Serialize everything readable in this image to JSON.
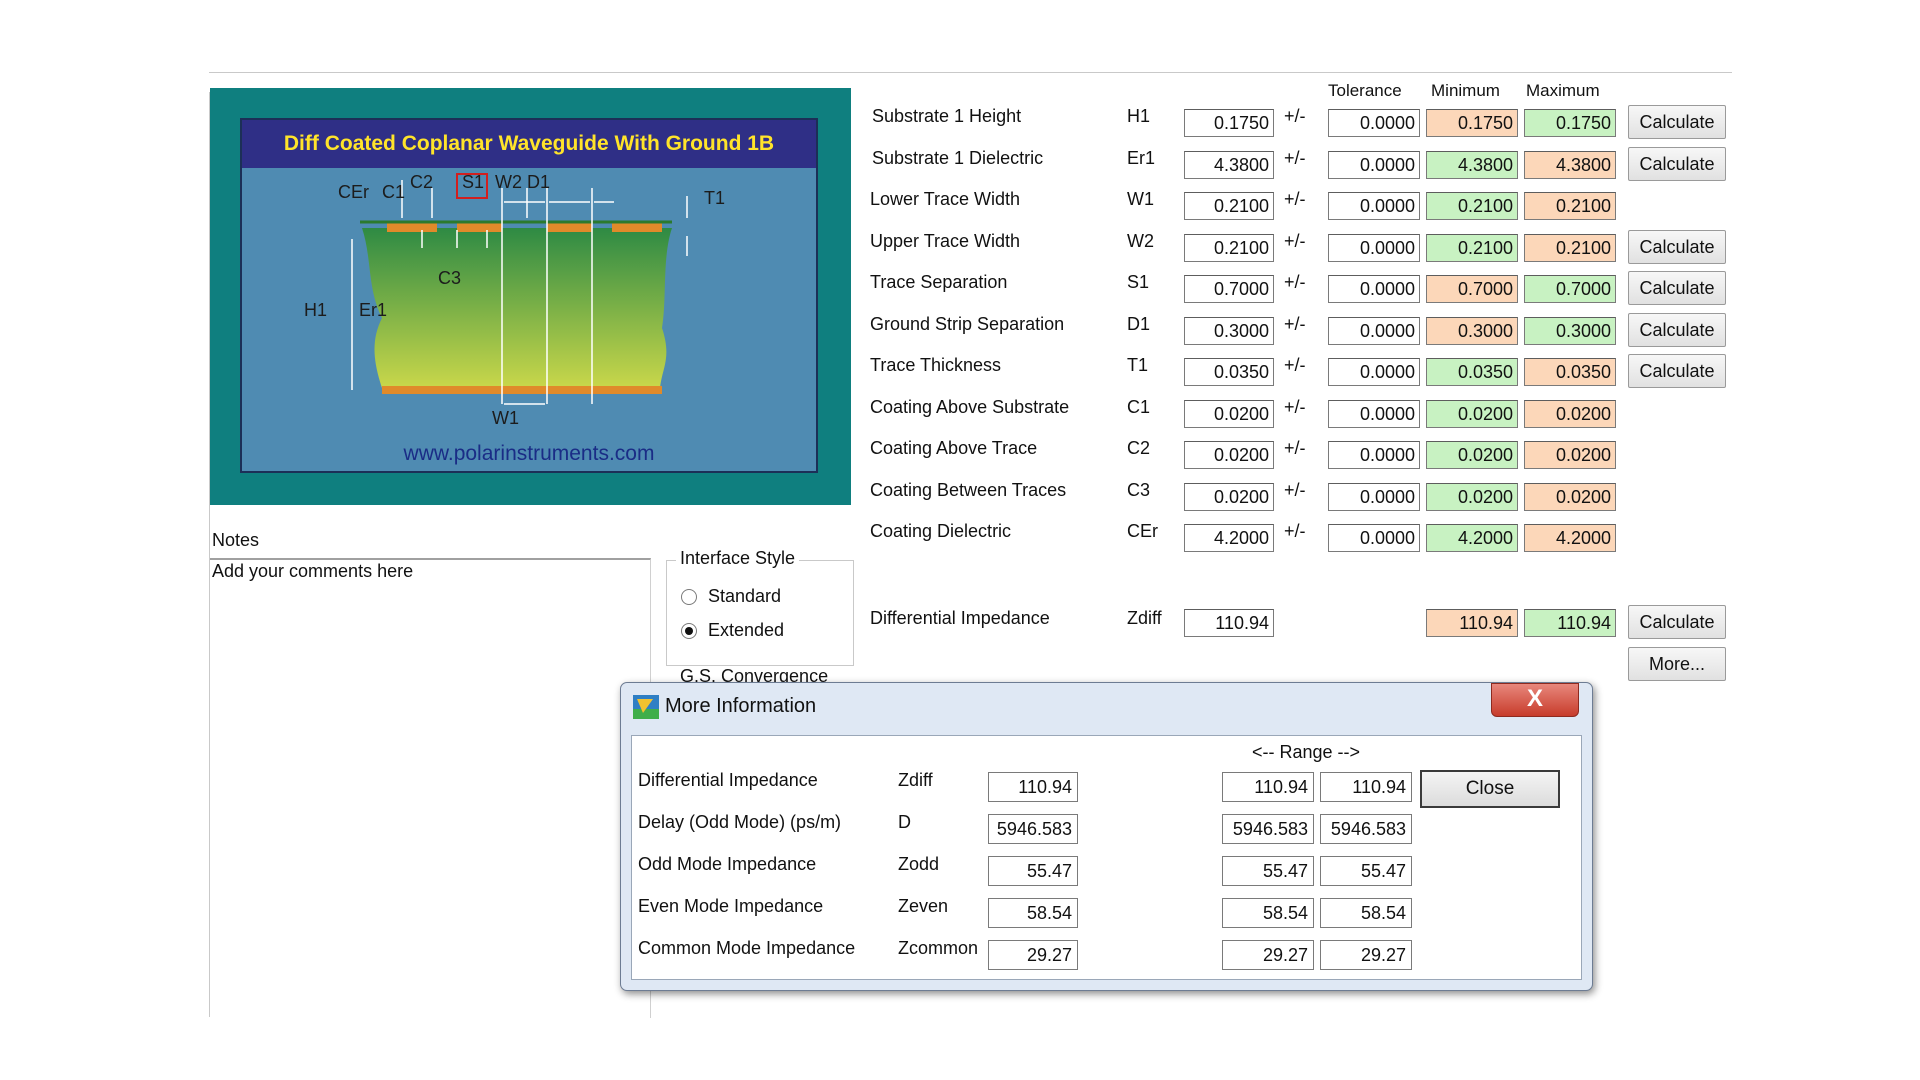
{
  "diagram": {
    "title": "Diff Coated Coplanar Waveguide With Ground 1B",
    "url": "www.polarinstruments.com",
    "labels": [
      "CEr",
      "C1",
      "C2",
      "S1",
      "W2",
      "D1",
      "T1",
      "C3",
      "H1",
      "Er1",
      "W1"
    ]
  },
  "table": {
    "header_tolerance": "Tolerance",
    "header_minimum": "Minimum",
    "header_maximum": "Maximum",
    "plusminus": "+/-",
    "rows": [
      {
        "label": "Substrate 1 Height",
        "symbol": "H1",
        "value": "0.1750",
        "tol": "0.0000",
        "min": "0.1750",
        "max": "0.1750",
        "button": "Calculate"
      },
      {
        "label": "Substrate 1 Dielectric",
        "symbol": "Er1",
        "value": "4.3800",
        "tol": "0.0000",
        "min": "4.3800",
        "max": "4.3800",
        "button": "Calculate"
      },
      {
        "label": "Lower Trace Width",
        "symbol": "W1",
        "value": "0.2100",
        "tol": "0.0000",
        "min": "0.2100",
        "max": "0.2100",
        "button": ""
      },
      {
        "label": "Upper Trace Width",
        "symbol": "W2",
        "value": "0.2100",
        "tol": "0.0000",
        "min": "0.2100",
        "max": "0.2100",
        "button": "Calculate"
      },
      {
        "label": "Trace Separation",
        "symbol": "S1",
        "value": "0.7000",
        "tol": "0.0000",
        "min": "0.7000",
        "max": "0.7000",
        "button": "Calculate"
      },
      {
        "label": "Ground Strip Separation",
        "symbol": "D1",
        "value": "0.3000",
        "tol": "0.0000",
        "min": "0.3000",
        "max": "0.3000",
        "button": "Calculate"
      },
      {
        "label": "Trace Thickness",
        "symbol": "T1",
        "value": "0.0350",
        "tol": "0.0000",
        "min": "0.0350",
        "max": "0.0350",
        "button": "Calculate"
      },
      {
        "label": "Coating Above Substrate",
        "symbol": "C1",
        "value": "0.0200",
        "tol": "0.0000",
        "min": "0.0200",
        "max": "0.0200",
        "button": ""
      },
      {
        "label": "Coating Above Trace",
        "symbol": "C2",
        "value": "0.0200",
        "tol": "0.0000",
        "min": "0.0200",
        "max": "0.0200",
        "button": ""
      },
      {
        "label": "Coating Between Traces",
        "symbol": "C3",
        "value": "0.0200",
        "tol": "0.0000",
        "min": "0.0200",
        "max": "0.0200",
        "button": ""
      },
      {
        "label": "Coating Dielectric",
        "symbol": "CEr",
        "value": "4.2000",
        "tol": "0.0000",
        "min": "4.2000",
        "max": "4.2000",
        "button": ""
      }
    ],
    "result": {
      "label": "Differential Impedance",
      "symbol": "Zdiff",
      "value": "110.94",
      "min": "110.94",
      "max": "110.94",
      "button": "Calculate"
    },
    "more_button": "More..."
  },
  "notes": {
    "label": "Notes",
    "text": "Add your comments here"
  },
  "interface_style": {
    "title": "Interface Style",
    "options": [
      "Standard",
      "Extended"
    ],
    "selected": "Extended",
    "next_group_title": "G.S. Convergence"
  },
  "dialog": {
    "title": "More Information",
    "close_x": "X",
    "range_label": "<-- Range -->",
    "close_button": "Close",
    "rows": [
      {
        "label": "Differential Impedance",
        "symbol": "Zdiff",
        "value": "110.94",
        "min": "110.94",
        "max": "110.94"
      },
      {
        "label": "Delay (Odd Mode) (ps/m)",
        "symbol": "D",
        "value": "5946.583",
        "min": "5946.583",
        "max": "5946.583"
      },
      {
        "label": "Odd Mode Impedance",
        "symbol": "Zodd",
        "value": "55.47",
        "min": "55.47",
        "max": "55.47"
      },
      {
        "label": "Even Mode Impedance",
        "symbol": "Zeven",
        "value": "58.54",
        "min": "58.54",
        "max": "58.54"
      },
      {
        "label": "Common Mode Impedance",
        "symbol": "Zcommon",
        "value": "29.27",
        "min": "29.27",
        "max": "29.27"
      }
    ]
  },
  "colors": {
    "min_orange": "#fcd7b9",
    "max_green": "#c8f2c2",
    "diagram_bg": "#0f7f7f",
    "title_yellow": "#ffe42a"
  }
}
